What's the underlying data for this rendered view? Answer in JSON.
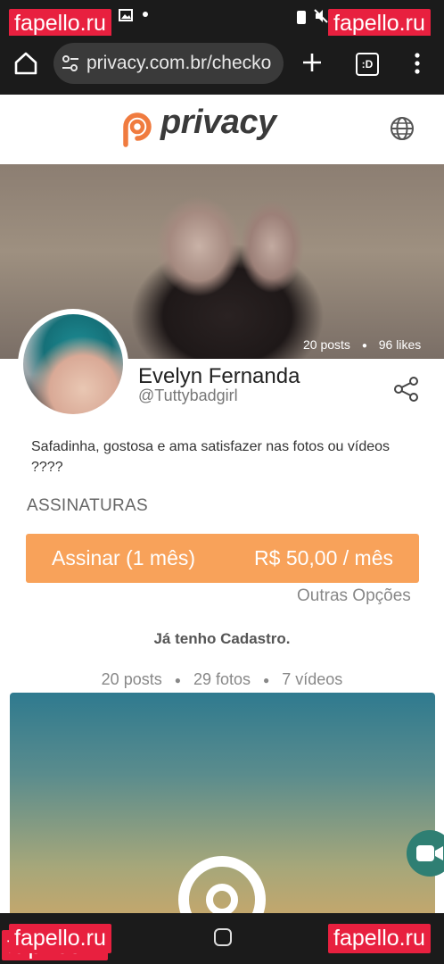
{
  "watermarks": {
    "brand": "fapello.ru",
    "brand_partial": "fap   .com"
  },
  "browser": {
    "url": "privacy.com.br/checko",
    "tabs_label": ":D"
  },
  "header": {
    "logo": "privacy",
    "language_icon": "globe-icon"
  },
  "profile": {
    "posts_stat": "20 posts",
    "likes_stat": "96 likes",
    "name": "Evelyn Fernanda",
    "handle": "@Tuttybadgirl",
    "bio": "Safadinha, gostosa e ama satisfazer nas fotos ou vídeos ????"
  },
  "subscriptions": {
    "title": "ASSINATURAS",
    "plan_label": "Assinar (1 mês)",
    "plan_price": "R$ 50,00 / mês",
    "other_options": "Outras Opções"
  },
  "already_registered": "Já tenho Cadastro.",
  "content_counts": {
    "posts": "20 posts",
    "photos": "29 fotos",
    "videos": "7 vídeos"
  },
  "colors": {
    "accent": "#f8a25a",
    "brand_orange": "#f07b3f",
    "watermark": "#e8203f"
  }
}
